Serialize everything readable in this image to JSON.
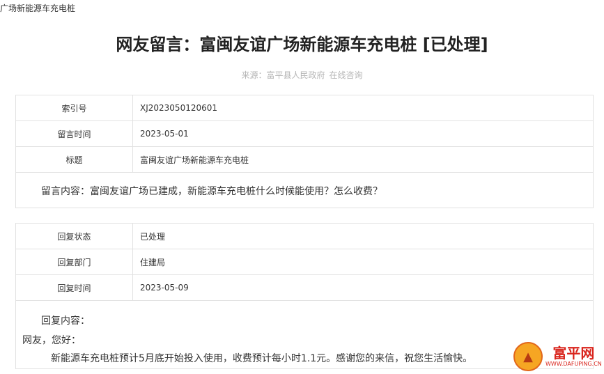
{
  "breadcrumb": "广场新能源车充电桩",
  "page_title": "网友留言：富闽友谊广场新能源车充电桩 [已处理]",
  "source": {
    "label": "来源：富平县人民政府",
    "link": "在线咨询"
  },
  "message": {
    "rows": [
      {
        "key": "索引号",
        "value": "XJ2023050120601"
      },
      {
        "key": "留言时间",
        "value": "2023-05-01"
      },
      {
        "key": "标题",
        "value": "富闽友谊广场新能源车充电桩"
      }
    ],
    "content": "留言内容：富闽友谊广场已建成，新能源车充电桩什么时候能使用？怎么收费？"
  },
  "reply": {
    "rows": [
      {
        "key": "回复状态",
        "value": "已处理"
      },
      {
        "key": "回复部门",
        "value": "住建局"
      },
      {
        "key": "回复时间",
        "value": "2023-05-09"
      }
    ],
    "content_label": "回复内容：",
    "greeting": "网友，您好：",
    "body": "新能源车充电桩预计5月底开始投入使用，收费预计每小时1.1元。感谢您的来信，祝您生活愉快。"
  },
  "logo": {
    "cn": "富平网",
    "en": "WWW.DAFUPING.CN",
    "icon": "tower-emblem-icon"
  }
}
